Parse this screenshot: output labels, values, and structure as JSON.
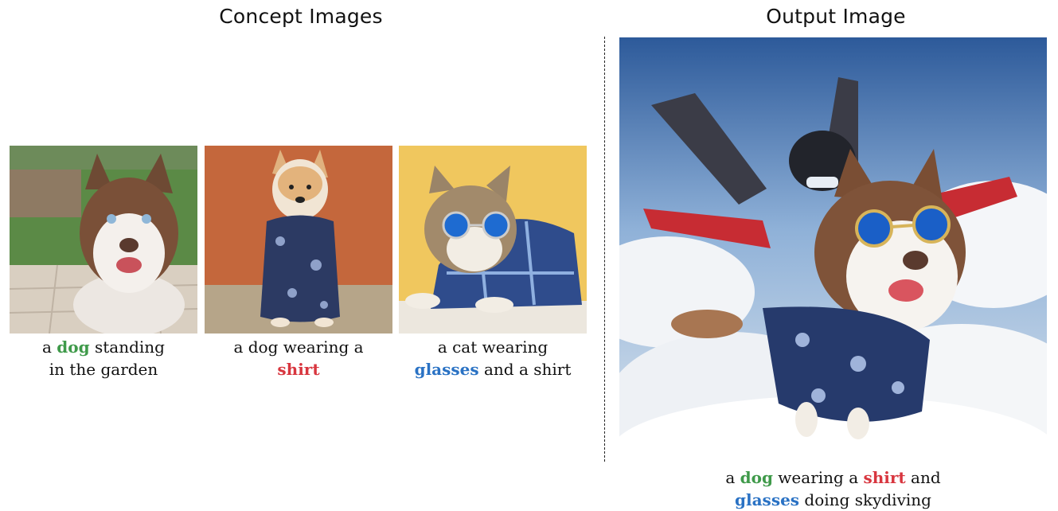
{
  "headings": {
    "concept": "Concept Images",
    "output": "Output Image"
  },
  "colors": {
    "concept_dog": "#3f9a4a",
    "concept_shirt": "#d8363f",
    "concept_glasses": "#2a72c4"
  },
  "concept_images": [
    {
      "caption": {
        "pre": "a ",
        "keyword": "dog",
        "post": " standing",
        "line2": "in the garden"
      }
    },
    {
      "caption": {
        "line1": "a dog wearing a",
        "keyword": "shirt"
      }
    },
    {
      "caption": {
        "line1": "a cat wearing",
        "keyword": "glasses",
        "post": " and a shirt"
      }
    }
  ],
  "output_image": {
    "caption": {
      "pre": "a ",
      "kw1": "dog",
      "mid1": " wearing a ",
      "kw2": "shirt",
      "mid2": " and",
      "kw3": "glasses",
      "post": " doing skydiving"
    }
  }
}
